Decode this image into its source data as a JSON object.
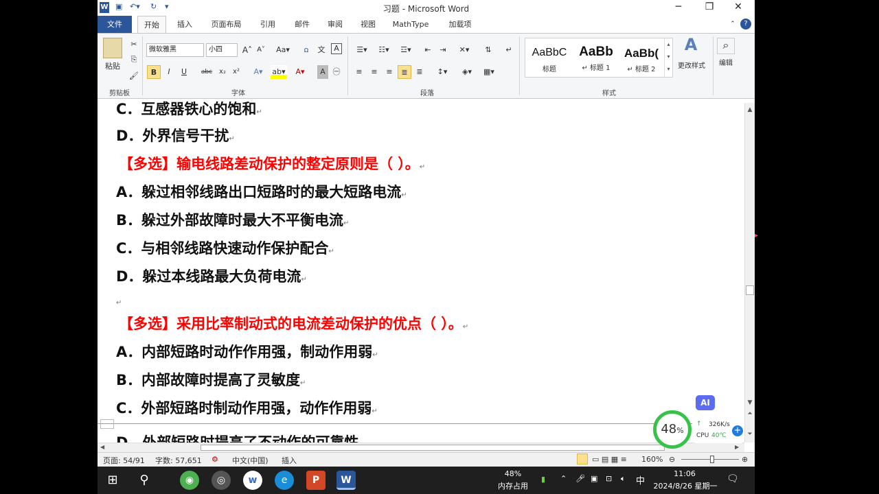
{
  "window": {
    "title": "习题 - Microsoft Word",
    "minimize": "─",
    "restore": "❐",
    "close": "✕"
  },
  "tabs": [
    "文件",
    "开始",
    "插入",
    "页面布局",
    "引用",
    "邮件",
    "审阅",
    "视图",
    "MathType",
    "加载项"
  ],
  "ribbon": {
    "clipboard": {
      "paste": "粘贴",
      "label": "剪贴板"
    },
    "font": {
      "name": "微软雅黑",
      "size": "小四",
      "label": "字体",
      "bold": "B",
      "italic": "I",
      "underline": "U",
      "strike": "abc",
      "sub": "x₂",
      "sup": "x²"
    },
    "paragraph": {
      "label": "段落"
    },
    "styles": {
      "label": "样式",
      "items": [
        {
          "sample": "AaBbC",
          "name": "标题"
        },
        {
          "sample": "AaBb",
          "name": "↵ 标题 1"
        },
        {
          "sample": "AaBb(",
          "name": "↵ 标题 2"
        }
      ],
      "change": "更改样式"
    },
    "edit": {
      "label": "编辑"
    }
  },
  "document": {
    "lines": [
      {
        "text": "C．互感器铁心的饱和",
        "red": false
      },
      {
        "text": "D．外界信号干扰",
        "red": false
      },
      {
        "text": "【多选】输电线路差动保护的整定原则是（   ）。",
        "red": true
      },
      {
        "text": "A．躲过相邻线路出口短路时的最大短路电流",
        "red": false
      },
      {
        "text": "B．躲过外部故障时最大不平衡电流",
        "red": false
      },
      {
        "text": "C．与相邻线路快速动作保护配合",
        "red": false
      },
      {
        "text": "D．躲过本线路最大负荷电流",
        "red": false
      },
      {
        "text": "",
        "red": false
      },
      {
        "text": "【多选】采用比率制动式的电流差动保护的优点（   ）。",
        "red": true
      },
      {
        "text": "A．内部短路时动作作用强，制动作用弱",
        "red": false
      },
      {
        "text": "B．内部故障时提高了灵敏度",
        "red": false
      },
      {
        "text": "C．外部短路时制动作用强，动作作用弱",
        "red": false
      },
      {
        "text": "D．外部短路时提高了不动作的可靠性",
        "red": false
      }
    ],
    "para_mark": "↵"
  },
  "status": {
    "page": "页面: 54/91",
    "words": "字数: 57,651",
    "lang": "中文(中国)",
    "mode": "插入",
    "zoom": "160%"
  },
  "overlay": {
    "ai": "AI",
    "gauge": "48",
    "gauge_unit": "%",
    "net": "326K/s",
    "cpu_label": "CPU",
    "cpu_temp": "40℃"
  },
  "taskbar": {
    "mem_pct": "48%",
    "mem_label": "内存占用",
    "ime": "中",
    "time": "11:06",
    "date": "2024/8/26 星期一"
  },
  "colors": {
    "accent": "#2b579a",
    "question": "#ff0000",
    "gauge": "#38c24a"
  }
}
